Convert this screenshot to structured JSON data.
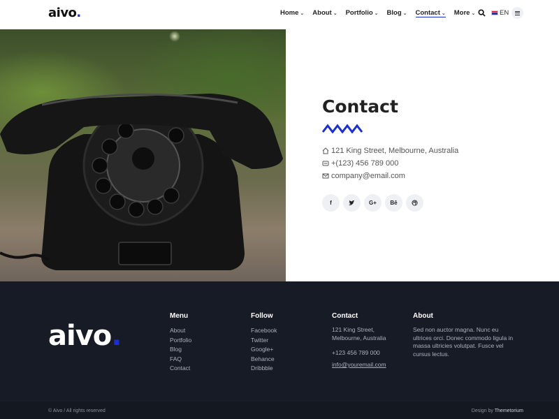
{
  "header": {
    "logo_text": "aivo",
    "logo_dot": ".",
    "nav": [
      {
        "label": "Home"
      },
      {
        "label": "About"
      },
      {
        "label": "Portfolio"
      },
      {
        "label": "Blog"
      },
      {
        "label": "Contact"
      },
      {
        "label": "More"
      }
    ],
    "lang": "EN"
  },
  "contact": {
    "title": "Contact",
    "address": "121 King Street, Melbourne, Australia",
    "phone": "+(123) 456 789 000",
    "email": "company@email.com",
    "socials": [
      "f",
      "t",
      "G+",
      "Bē",
      "dribbble"
    ]
  },
  "footer": {
    "logo_text": "aivo",
    "logo_dot": ".",
    "menu": {
      "title": "Menu",
      "links": [
        "About",
        "Portfolio",
        "Blog",
        "FAQ",
        "Contact"
      ]
    },
    "follow": {
      "title": "Follow",
      "links": [
        "Facebook",
        "Twitter",
        "Google+",
        "Behance",
        "Dribbble"
      ]
    },
    "contact": {
      "title": "Contact",
      "address_line1": "121 King Street,",
      "address_line2": "Melbourne, Australia",
      "phone": "+123 456 789 000",
      "email": "info@youremail.com"
    },
    "about": {
      "title": "About",
      "text": "Sed non auctor magna. Nunc eu ultrices orci. Donec commodo ligula in massa ultricies volutpat. Fusce vel cursus lectus."
    },
    "copyright": "© Aivo / All rights reserved",
    "design_prefix": "Design by",
    "design_name": "Themetorium"
  },
  "colors": {
    "accent": "#1b2fd1",
    "footer_bg": "#171b26"
  }
}
